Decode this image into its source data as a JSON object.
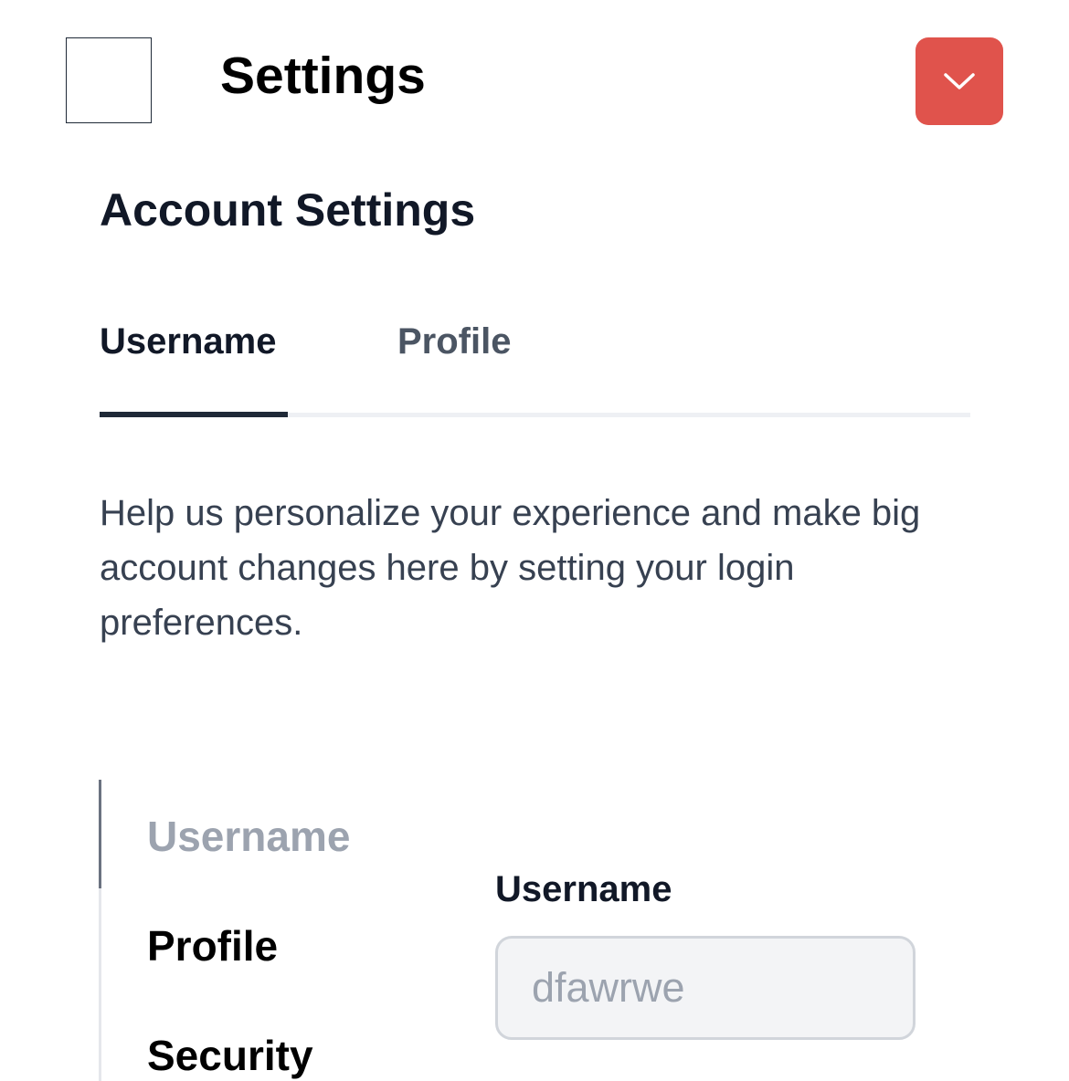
{
  "header": {
    "title": "Settings",
    "menu_icon": "blank-square",
    "dropdown_icon": "chevron-down-icon",
    "dropdown_color": "#e0534c"
  },
  "section": {
    "title": "Account Settings"
  },
  "tabs": [
    {
      "label": "Username",
      "active": true
    },
    {
      "label": "Profile",
      "active": false
    }
  ],
  "description": "Help us personalize your experience and make big account changes here by setting your login preferences.",
  "side_nav": {
    "items": [
      {
        "label": "Username",
        "active": true
      },
      {
        "label": "Profile",
        "active": false
      },
      {
        "label": "Security",
        "active": false
      }
    ]
  },
  "form": {
    "username_label": "Username",
    "username_value": "dfawrwe"
  }
}
